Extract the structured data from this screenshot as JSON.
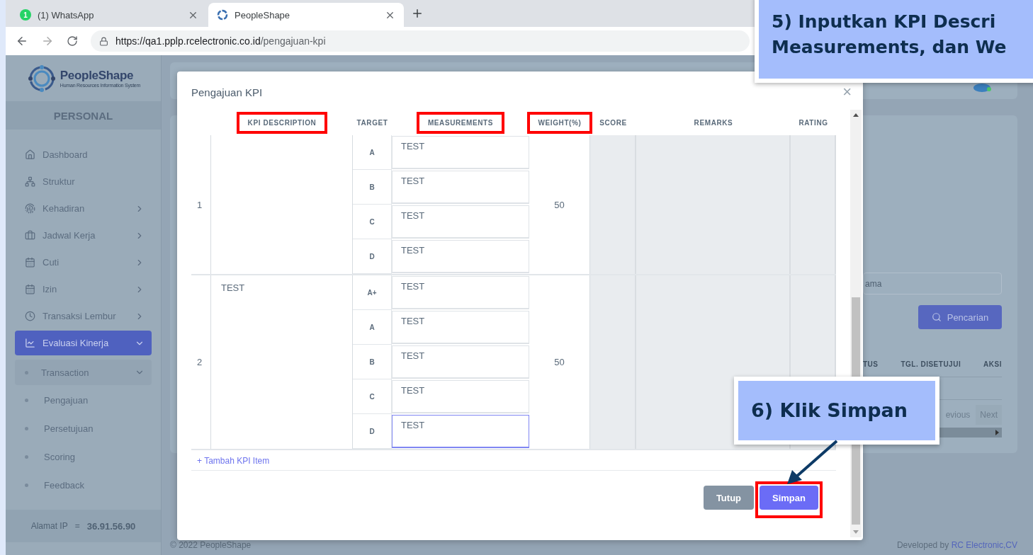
{
  "browser": {
    "tabs": [
      {
        "title": "(1) WhatsApp",
        "badge": "1",
        "selected": false
      },
      {
        "title": "PeopleShape",
        "selected": true
      }
    ],
    "url_host": "https://qa1.pplp.rcelectronic.co.id",
    "url_path": "/pengajuan-kpi"
  },
  "sidebar": {
    "brand": "PeopleShape",
    "tagline": "Human Resources Information System",
    "section": "PERSONAL",
    "items": [
      {
        "label": "Dashboard",
        "selected": false
      },
      {
        "label": "Struktur",
        "selected": false
      },
      {
        "label": "Kehadiran",
        "selected": false,
        "expanded": false
      },
      {
        "label": "Jadwal Kerja",
        "selected": false,
        "expanded": false
      },
      {
        "label": "Cuti",
        "selected": false,
        "expanded": false
      },
      {
        "label": "Izin",
        "selected": false,
        "expanded": false
      },
      {
        "label": "Transaksi Lembur",
        "selected": false,
        "expanded": false
      },
      {
        "label": "Evaluasi Kinerja",
        "selected": true,
        "expanded": true,
        "children": [
          {
            "label": "Transaction",
            "expanded": true,
            "children": [
              {
                "label": "Pengajuan"
              },
              {
                "label": "Persetujuan"
              },
              {
                "label": "Scoring"
              },
              {
                "label": "Feedback"
              }
            ]
          }
        ]
      }
    ],
    "ip_label": "Alamat IP",
    "ip_separator": "=",
    "ip_value": "36.91.56.90"
  },
  "background": {
    "search_placeholder": "ama",
    "search_button": "Pencarian",
    "columns": [
      "TUS",
      "TGL. DISETUJUI",
      "AKSI"
    ],
    "pagination": [
      "evious",
      "Next"
    ]
  },
  "modal": {
    "title": "Pengajuan KPI",
    "close": "×",
    "columns": [
      {
        "label": "KPI DESCRIPTION",
        "highlighted": true
      },
      {
        "label": "TARGET",
        "highlighted": false
      },
      {
        "label": "MEASUREMENTS",
        "highlighted": true
      },
      {
        "label": "WEIGHT(%)",
        "highlighted": true
      },
      {
        "label": "SCORE",
        "highlighted": false
      },
      {
        "label": "REMARKS",
        "highlighted": false
      },
      {
        "label": "RATING",
        "highlighted": false
      }
    ],
    "rows": [
      {
        "number": "1",
        "weight": "50",
        "targets": [
          {
            "grade": "A",
            "measurement": "TEST",
            "focused": false
          },
          {
            "grade": "B",
            "measurement": "TEST",
            "focused": false
          },
          {
            "grade": "C",
            "measurement": "TEST",
            "focused": false
          },
          {
            "grade": "D",
            "measurement": "TEST",
            "focused": false
          }
        ]
      },
      {
        "number": "2",
        "description": "TEST",
        "weight": "50",
        "targets": [
          {
            "grade": "A+",
            "measurement": "TEST",
            "focused": false
          },
          {
            "grade": "A",
            "measurement": "TEST",
            "focused": false
          },
          {
            "grade": "B",
            "measurement": "TEST",
            "focused": false
          },
          {
            "grade": "C",
            "measurement": "TEST",
            "focused": false
          },
          {
            "grade": "D",
            "measurement": "TEST",
            "focused": true
          }
        ]
      }
    ],
    "add_link": "+ Tambah KPI Item",
    "buttons": [
      {
        "label": "Tutup",
        "kind": "secondary",
        "highlighted": false
      },
      {
        "label": "Simpan",
        "kind": "primary",
        "highlighted": true
      }
    ]
  },
  "footer": {
    "copyright": "© 2022 PeopleShape",
    "developed_by": "Developed by",
    "developer": "RC Electronic,CV"
  },
  "callouts": [
    {
      "lines": [
        "5) Inputkan KPI Descri",
        "Measurements, dan We"
      ]
    },
    {
      "lines": [
        "6) Klik Simpan"
      ]
    }
  ]
}
